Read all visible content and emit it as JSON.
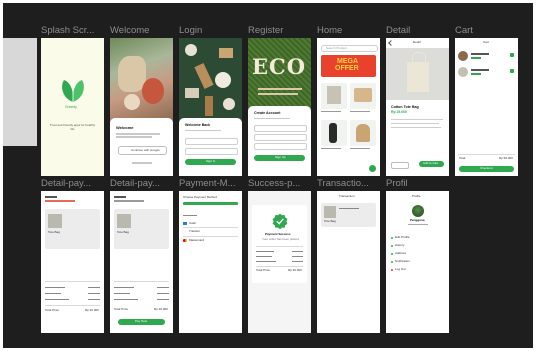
{
  "frames": {
    "row1": [
      {
        "label": "Splash Scr..."
      },
      {
        "label": "Welcome"
      },
      {
        "label": "Login"
      },
      {
        "label": "Register"
      },
      {
        "label": "Home"
      },
      {
        "label": "Detail"
      },
      {
        "label": "Cart"
      }
    ],
    "row2": [
      {
        "label": "Detail-pay..."
      },
      {
        "label": "Detail-pay..."
      },
      {
        "label": "Payment-M..."
      },
      {
        "label": "Success-p..."
      },
      {
        "label": "Transactio..."
      },
      {
        "label": "Profil"
      }
    ]
  },
  "splash": {
    "brand": "Greenly",
    "tagline": "Trust and friendly apps for healthy life"
  },
  "welcome": {
    "title": "Welcome",
    "button": "Continue with Google"
  },
  "login": {
    "title": "Welcome Back",
    "button": "Sign In"
  },
  "register": {
    "hero_text": "ECO",
    "title": "Create Account",
    "button": "Sign Up"
  },
  "home": {
    "search": "Search Product",
    "banner_line1": "MEGA",
    "banner_line2": "OFFER"
  },
  "detail": {
    "header": "Detail",
    "product": "Cotton Tote Bag",
    "price": "Rp 25.000",
    "button": "Add to Cart"
  },
  "cart": {
    "header": "Cart",
    "total_label": "Total",
    "total_value": "Rp 50.000",
    "button": "Checkout"
  },
  "payment_detail": {
    "product": "Tote Bag",
    "total_label": "Total Price",
    "total_value": "Rp 30.000",
    "button": "Pay Now"
  },
  "payment_method": {
    "title": "Choose Payment Method",
    "options": [
      "Cash",
      "Transfer",
      "Mastercard"
    ]
  },
  "success": {
    "title": "Payment Success",
    "subtitle": "Your order has been placed",
    "total_label": "Total Price",
    "total_value": "Rp 30.000"
  },
  "transaction": {
    "header": "Transaction",
    "product": "Tote Bag"
  },
  "profile": {
    "header": "Profile",
    "name": "Pengguna",
    "menu": [
      "Edit Profile",
      "History",
      "Address",
      "Notification",
      "Log Out"
    ]
  },
  "colors": {
    "canvas": "#1e1e1e",
    "accent": "#2fa84f",
    "offer": "#e8412c",
    "offer_text": "#ffd23a"
  }
}
